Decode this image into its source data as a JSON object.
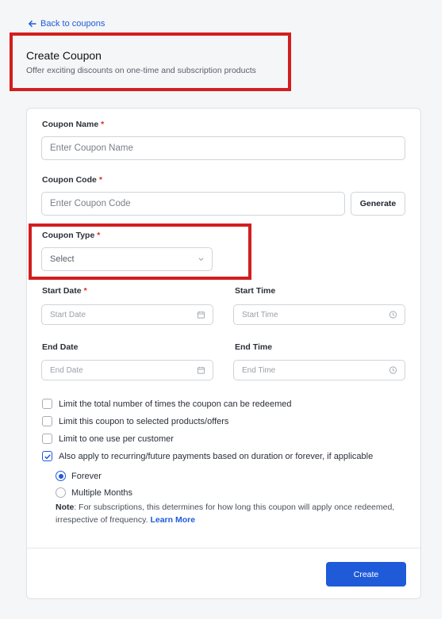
{
  "nav": {
    "back_label": "Back to coupons"
  },
  "header": {
    "title": "Create Coupon",
    "subtitle": "Offer exciting discounts on one-time and subscription products"
  },
  "form": {
    "coupon_name": {
      "label": "Coupon Name",
      "required": "*",
      "placeholder": "Enter Coupon Name"
    },
    "coupon_code": {
      "label": "Coupon Code",
      "required": "*",
      "placeholder": "Enter Coupon Code",
      "generate_label": "Generate"
    },
    "coupon_type": {
      "label": "Coupon Type",
      "required": "*",
      "selected": "Select"
    },
    "start_date": {
      "label": "Start Date",
      "required": "*",
      "placeholder": "Start Date"
    },
    "start_time": {
      "label": "Start Time",
      "placeholder": "Start Time"
    },
    "end_date": {
      "label": "End Date",
      "placeholder": "End Date"
    },
    "end_time": {
      "label": "End Time",
      "placeholder": "End Time"
    },
    "checkboxes": [
      {
        "label": "Limit the total number of times the coupon can be redeemed",
        "checked": false
      },
      {
        "label": "Limit this coupon to selected products/offers",
        "checked": false
      },
      {
        "label": "Limit to one use per customer",
        "checked": false
      },
      {
        "label": "Also apply to recurring/future payments based on duration or forever, if applicable",
        "checked": true
      }
    ],
    "duration_options": [
      {
        "label": "Forever",
        "selected": true
      },
      {
        "label": "Multiple Months",
        "selected": false
      }
    ],
    "note": {
      "prefix": "Note",
      "text": ": For subscriptions, this determines for how long this coupon will apply once redeemed, irrespective of frequency. ",
      "link": "Learn More"
    },
    "create_label": "Create"
  },
  "colors": {
    "accent": "#1f5bd8",
    "highlight": "#d21e1e",
    "required": "#d92d20"
  },
  "icons": [
    "arrow-left-icon",
    "calendar-icon",
    "clock-icon",
    "chevron-down-icon",
    "checkmark-icon"
  ]
}
